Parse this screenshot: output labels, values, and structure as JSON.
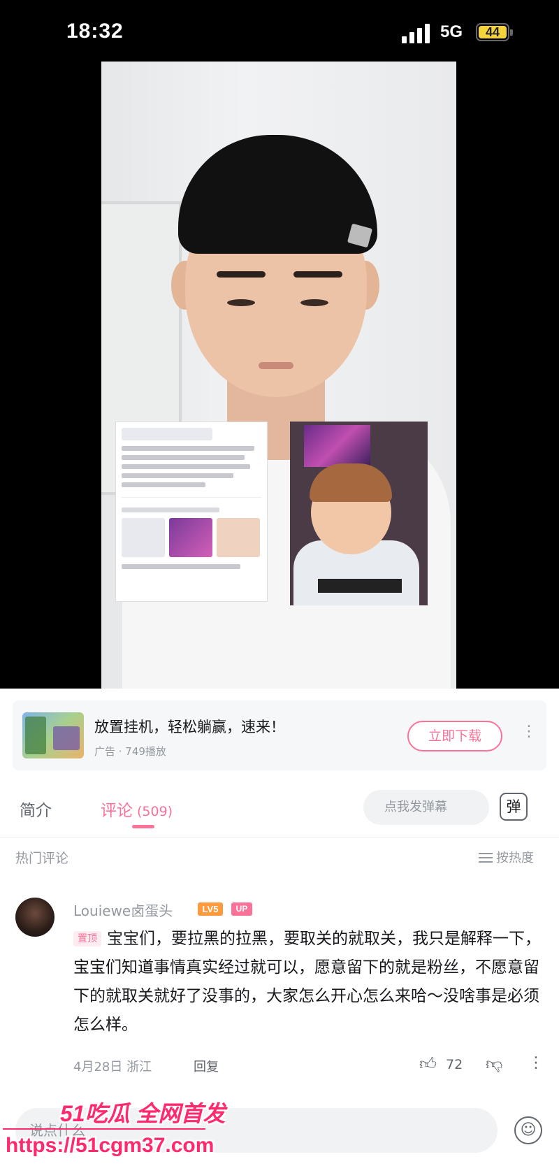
{
  "status_bar": {
    "time": "18:32",
    "network": "5G",
    "battery": "44",
    "battery_color": "#f5d33a"
  },
  "video": {
    "area": "video-player",
    "icons": [
      "signal-icon",
      "battery-icon"
    ]
  },
  "ad": {
    "title": "放置挂机，轻松躺赢，速来！",
    "meta": "广告 · 749播放",
    "button_label": "立即下载",
    "accent_color": "#fb7299"
  },
  "tabs": {
    "intro": "简介",
    "comments": "评论",
    "comments_count": "(509)",
    "danmaku_placeholder": "点我发弹幕",
    "danmaku_icon_text": "弹"
  },
  "hot": {
    "label": "热门评论",
    "sort_label": "按热度"
  },
  "comment": {
    "username": "Louiewe卤蛋头",
    "level": "LV5",
    "up_badge": "UP",
    "pin_label": "置顶",
    "text": "宝宝们，要拉黑的拉黑，要取关的就取关，我只是解释一下，宝宝们知道事情真实经过就可以，愿意留下的就是粉丝，不愿意留下的就取关就好了没事的，大家怎么开心怎么来哈～没啥事是必须怎么样。",
    "date_location": "4月28日 浙江",
    "reply_label": "回复",
    "likes": "72"
  },
  "bottom": {
    "placeholder": "说点什么"
  },
  "watermark": {
    "brand": "51吃瓜 全网首发",
    "url": "https://51cgm37.com"
  }
}
